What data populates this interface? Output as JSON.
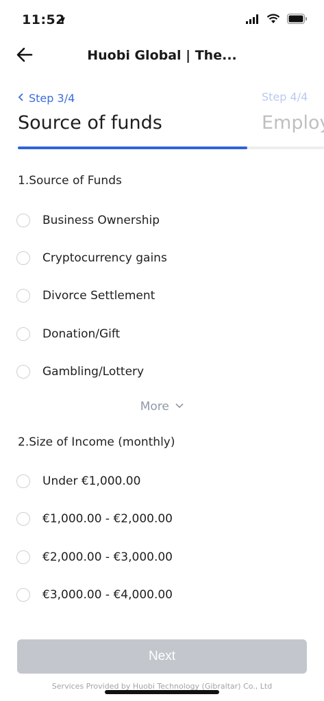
{
  "status": {
    "time": "11:52"
  },
  "nav": {
    "title": "Huobi Global | The..."
  },
  "steps": {
    "current": {
      "label": "Step 3/4",
      "title": "Source of funds"
    },
    "next": {
      "label": "Step 4/4",
      "title": "Employ"
    },
    "progress_fraction": 0.75
  },
  "sections": {
    "funds": {
      "title": "1.Source of Funds",
      "options": [
        "Business Ownership",
        "Cryptocurrency gains",
        "Divorce Settlement",
        "Donation/Gift",
        "Gambling/Lottery"
      ],
      "more": "More"
    },
    "income": {
      "title": "2.Size of Income (monthly)",
      "options": [
        "Under €1,000.00",
        "€1,000.00 - €2,000.00",
        "€2,000.00 - €3,000.00",
        "€3,000.00 - €4,000.00"
      ]
    }
  },
  "footer": {
    "next_label": "Next",
    "services_text": "Services Provided by Huobi Technology (Gibraltar) Co., Ltd"
  },
  "colors": {
    "accent": "#2f63d8",
    "disabled_button": "#c3c7cd"
  }
}
